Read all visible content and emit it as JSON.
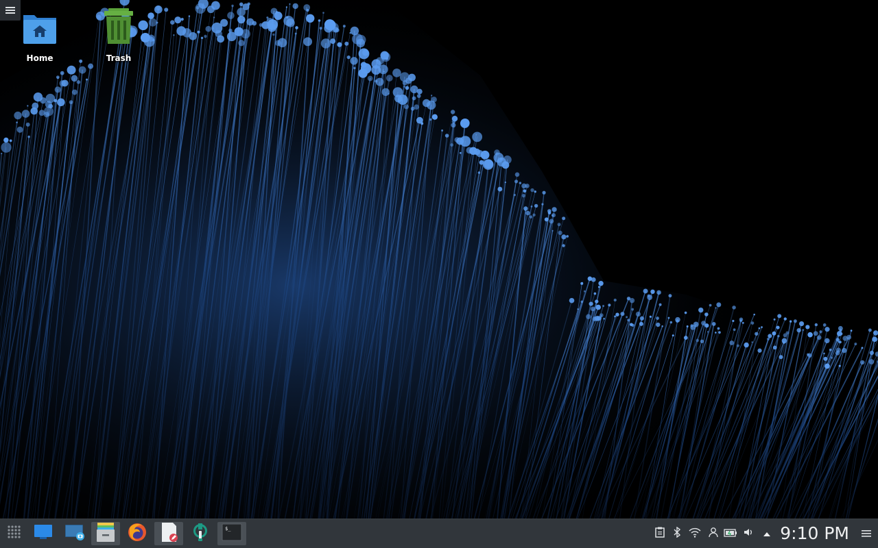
{
  "desktop": {
    "icons": [
      {
        "label": "Home",
        "icon": "home-folder-icon"
      },
      {
        "label": "Trash",
        "icon": "trash-icon"
      }
    ]
  },
  "taskbar": {
    "launchers": [
      {
        "name": "application-launcher",
        "icon": "app-grid-icon"
      },
      {
        "name": "show-desktop",
        "icon": "desktop-icon"
      },
      {
        "name": "screenshot",
        "icon": "screenshot-icon"
      },
      {
        "name": "file-manager",
        "icon": "file-manager-icon"
      },
      {
        "name": "firefox",
        "icon": "firefox-icon"
      },
      {
        "name": "text-editor",
        "icon": "text-editor-icon"
      },
      {
        "name": "settings",
        "icon": "settings-icon"
      },
      {
        "name": "terminal",
        "icon": "terminal-icon"
      }
    ],
    "tray": [
      "clipboard-icon",
      "bluetooth-icon",
      "wifi-icon",
      "user-icon",
      "battery-icon",
      "volume-icon",
      "tray-expand-icon"
    ],
    "clock": "9:10 PM"
  },
  "colors": {
    "panel": "#31363b",
    "accent": "#3daee9",
    "wallpaper_fiber": "#3b6fb6"
  }
}
